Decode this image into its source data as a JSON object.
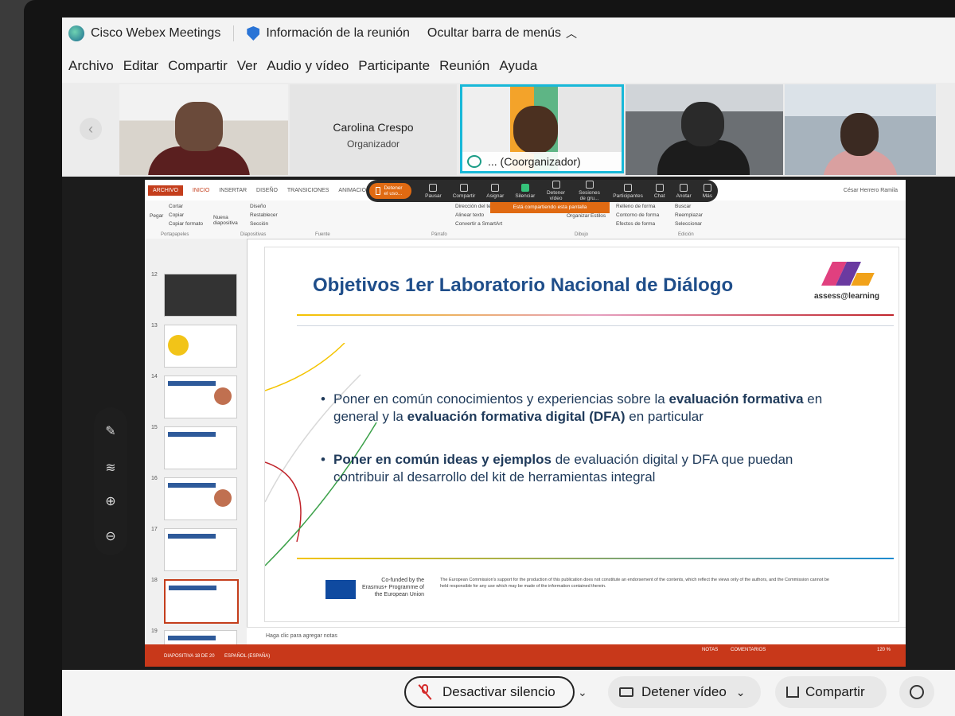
{
  "titlebar": {
    "app_name": "Cisco Webex Meetings",
    "meeting_info": "Información de la reunión",
    "hide_menu": "Ocultar barra de menús"
  },
  "menu": [
    "Archivo",
    "Editar",
    "Compartir",
    "Ver",
    "Audio y vídeo",
    "Participante",
    "Reunión",
    "Ayuda"
  ],
  "participants": {
    "organizer_name": "Carolina Crespo",
    "organizer_role": "Organizador",
    "active_label": "... (Coorganizador)"
  },
  "share_toolbar": {
    "stop": "Detener el uso...",
    "buttons": [
      "Pausar",
      "Compartir",
      "Asignar",
      "Silenciar",
      "Detener vídeo",
      "Sesiones de gru...",
      "Participantes",
      "Chat",
      "Anotar",
      "Más"
    ],
    "banner": "Está compartiendo esta pantalla"
  },
  "powerpoint": {
    "tabs": [
      "ARCHIVO",
      "INICIO",
      "INSERTAR",
      "DISEÑO",
      "TRANSICIONES",
      "ANIMACIONES"
    ],
    "user": "César Herrero Ramila",
    "ribbon": {
      "paste": "Pegar",
      "cut": "Cortar",
      "copy": "Copiar",
      "format_painter": "Copiar formato",
      "new_slide": "Nueva diapositiva",
      "layout": "Diseño",
      "reset": "Restablecer",
      "section": "Sección",
      "text_direction": "Dirección del texto",
      "align_text": "Alinear texto",
      "convert_smartart": "Convertir a SmartArt",
      "arrange": "Organizar",
      "fill": "Relleno de forma",
      "outline": "Contorno de forma",
      "effects": "Efectos de forma",
      "styles": "Estilos",
      "find": "Buscar",
      "replace": "Reemplazar",
      "select": "Seleccionar",
      "group_clipboard": "Portapapeles",
      "group_slides": "Diapositivas",
      "group_font": "Fuente",
      "group_paragraph": "Párrafo",
      "group_drawing": "Dibujo",
      "group_editing": "Edición"
    },
    "thumbnails": [
      "12",
      "13",
      "14",
      "15",
      "16",
      "17",
      "18",
      "19"
    ],
    "notes_placeholder": "Haga clic para agregar notas",
    "status_slide": "DIAPOSITIVA 18 DE 20",
    "status_lang": "ESPAÑOL (ESPAÑA)",
    "status_notes": "NOTAS",
    "status_comments": "COMENTARIOS",
    "zoom": "120 %"
  },
  "slide": {
    "title": "Objetivos 1er Laboratorio Nacional de Diálogo",
    "logo_text": "assess@learning",
    "bullet1_a": "Poner en común conocimientos y experiencias sobre la ",
    "bullet1_b": "evaluación formativa",
    "bullet1_c": " en general y la ",
    "bullet1_d": "evaluación formativa digital (DFA)",
    "bullet1_e": " en particular",
    "bullet2_a": "Poner en común ideas y ejemplos",
    "bullet2_b": " de evaluación digital y DFA que puedan contribuir al desarrollo del kit de herramientas integral",
    "eu_text": "Co-funded by the Erasmus+ Programme of the European Union",
    "disclaimer": "The European Commission's support for the production of this publication does not constitute an endorsement of the contents, which reflect the views only of the authors, and the Commission cannot be held responsible for any use which may be made of the information contained therein."
  },
  "controls": {
    "mute": "Desactivar silencio",
    "video": "Detener vídeo",
    "share": "Compartir"
  },
  "colors": {
    "accent_cyan": "#18b8d8",
    "ppt_red": "#c43e1c",
    "webex_orange": "#e06a12",
    "title_blue": "#1f4e8a"
  }
}
